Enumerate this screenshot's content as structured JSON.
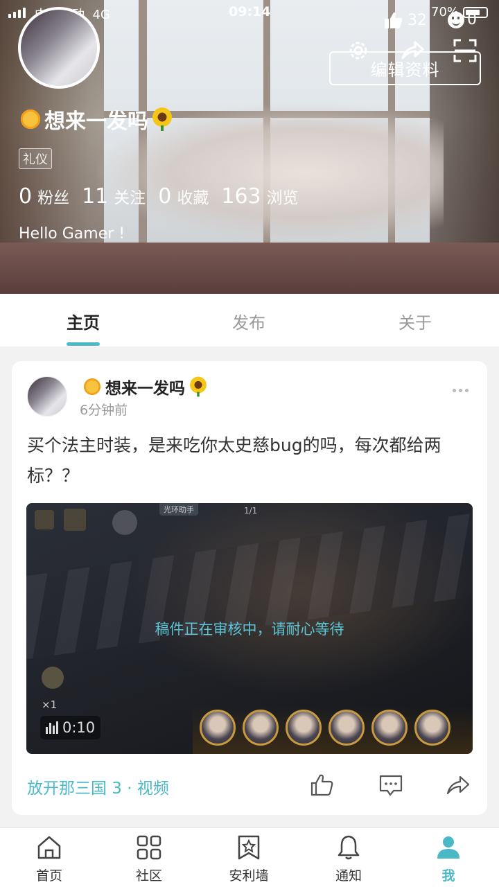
{
  "status_bar": {
    "carrier": "中国移动",
    "network": "4G",
    "time": "09:14",
    "battery": "70%"
  },
  "profile": {
    "likes_count": "32",
    "smile_count": "0",
    "edit_button": "编辑资料",
    "nickname": "想来一发吗",
    "tag": "礼仪",
    "stats": [
      {
        "value": "0",
        "label": "粉丝"
      },
      {
        "value": "11",
        "label": "关注"
      },
      {
        "value": "0",
        "label": "收藏"
      },
      {
        "value": "163",
        "label": "浏览"
      }
    ],
    "bio": "Hello Gamer !"
  },
  "tabs": [
    {
      "label": "主页",
      "active": true
    },
    {
      "label": "发布",
      "active": false
    },
    {
      "label": "关于",
      "active": false
    }
  ],
  "post": {
    "author": "想来一发吗",
    "time": "6分钟前",
    "text": "买个法主时装，是来吃你太史慈bug的吗，每次都给两标？？",
    "video": {
      "review_status": "稿件正在审核中，请耐心等待",
      "duration": "0:10",
      "top_label": "光环助手",
      "counter": "1/1",
      "speed": "×1"
    },
    "topic": "放开那三国 3 · 视频"
  },
  "bottom_nav": [
    {
      "label": "首页",
      "icon": "home-icon",
      "active": false
    },
    {
      "label": "社区",
      "icon": "grid-icon",
      "active": false
    },
    {
      "label": "安利墙",
      "icon": "star-bookmark-icon",
      "active": false
    },
    {
      "label": "通知",
      "icon": "bell-icon",
      "active": false
    },
    {
      "label": "我",
      "icon": "user-icon",
      "active": true
    }
  ],
  "colors": {
    "accent": "#4bb8c8",
    "text_primary": "#222222",
    "text_secondary": "#999999"
  }
}
